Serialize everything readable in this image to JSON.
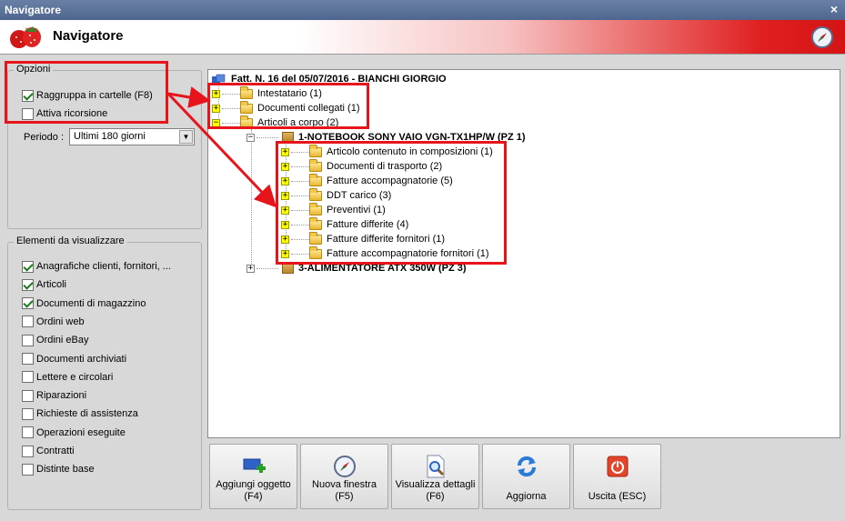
{
  "window": {
    "title": "Navigatore",
    "close_glyph": "×"
  },
  "header": {
    "title": "Navigatore",
    "logo": "strawberry-logo",
    "right_icon": "compass-icon"
  },
  "options": {
    "legend": "Opzioni",
    "group_folders": {
      "label": "Raggruppa in cartelle (F8)",
      "checked": true
    },
    "recursion": {
      "label": "Attiva ricorsione",
      "checked": false
    },
    "period_label": "Periodo :",
    "period_value": "Ultimi 180 giorni"
  },
  "elements": {
    "legend": "Elementi da visualizzare",
    "items": [
      {
        "label": "Anagrafiche clienti, fornitori, ...",
        "checked": true
      },
      {
        "label": "Articoli",
        "checked": true
      },
      {
        "label": "Documenti di magazzino",
        "checked": true
      },
      {
        "label": "Ordini web",
        "checked": false
      },
      {
        "label": "Ordini eBay",
        "checked": false
      },
      {
        "label": "Documenti archiviati",
        "checked": false
      },
      {
        "label": "Lettere e circolari",
        "checked": false
      },
      {
        "label": "Riparazioni",
        "checked": false
      },
      {
        "label": "Richieste di assistenza",
        "checked": false
      },
      {
        "label": "Operazioni eseguite",
        "checked": false
      },
      {
        "label": "Contratti",
        "checked": false
      },
      {
        "label": "Distinte base",
        "checked": false
      }
    ]
  },
  "tree": {
    "root": "Fatt. N. 16 del 05/07/2016 - BIANCHI GIORGIO",
    "root_folders": [
      {
        "label": "Intestatario (1)",
        "expander": "+"
      },
      {
        "label": "Documenti collegati (1)",
        "expander": "+"
      },
      {
        "label": "Articoli a corpo (2)",
        "expander": "−"
      }
    ],
    "item1": "1-NOTEBOOK SONY VAIO VGN-TX1HP/W    (PZ 1)",
    "item1_folders": [
      "Articolo contenuto in composizioni (1)",
      "Documenti di trasporto (2)",
      "Fatture accompagnatorie (5)",
      "DDT carico (3)",
      "Preventivi (1)",
      "Fatture differite (4)",
      "Fatture differite fornitori (1)",
      "Fatture accompagnatorie fornitori (1)"
    ],
    "item2": "3-ALIMENTATORE ATX 350W (PZ 3)",
    "expander_minus": "−",
    "expander_plus": "+"
  },
  "toolbar": [
    {
      "label": "Aggiungi oggetto\n(F4)",
      "icon": "add-object-icon"
    },
    {
      "label": "Nuova finestra\n(F5)",
      "icon": "compass-icon"
    },
    {
      "label": "Visualizza dettagli\n(F6)",
      "icon": "details-icon"
    },
    {
      "label": "Aggiorna",
      "icon": "refresh-icon"
    },
    {
      "label": "Uscita (ESC)",
      "icon": "exit-icon"
    }
  ],
  "colors": {
    "highlight": "#e8141c",
    "expander_highlight": "#ffff00"
  }
}
